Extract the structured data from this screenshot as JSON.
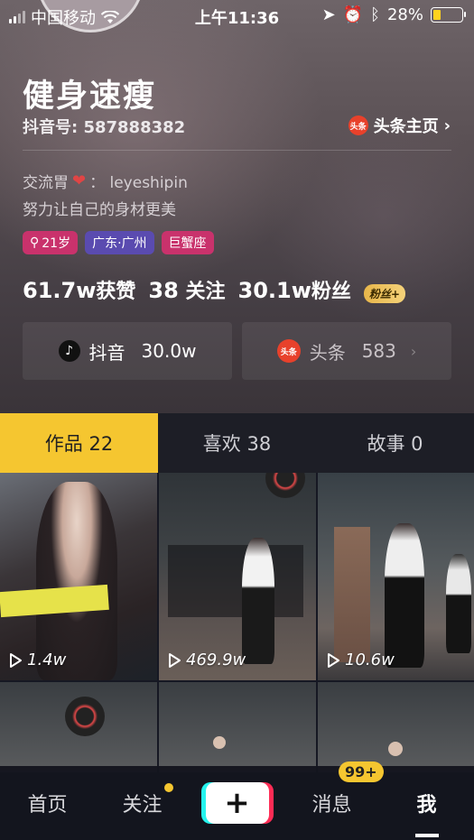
{
  "status_bar": {
    "carrier": "中国移动",
    "time": "上午11:36",
    "battery": "28%"
  },
  "profile": {
    "name": "健身速瘦",
    "douyin_id": "抖音号: 587888382",
    "toutiao_home": "头条主页",
    "toutiao_logo_text": "头条",
    "bio_prefix": "交流胃",
    "bio_suffix": "：  leyeshipin",
    "bio_line2": "努力让自己的身材更美",
    "tags": [
      "21岁",
      "广东·广州",
      "巨蟹座"
    ],
    "likes_num": "61.7w",
    "likes_label": "获赞",
    "following_num": "38",
    "following_label": "关注",
    "fans_num": "30.1w",
    "fans_label": "粉丝",
    "fans_badge": "粉丝+"
  },
  "platforms": {
    "douyin_label": "抖音",
    "douyin_count": "30.0w",
    "toutiao_label": "头条",
    "toutiao_count": "583"
  },
  "tabs": [
    {
      "label": "作品 22"
    },
    {
      "label": "喜欢 38"
    },
    {
      "label": "故事 0"
    }
  ],
  "videos": [
    {
      "plays": "1.4w"
    },
    {
      "plays": "469.9w"
    },
    {
      "plays": "10.6w"
    }
  ],
  "bottom_nav": {
    "home": "首页",
    "follow": "关注",
    "messages": "消息",
    "messages_badge": "99+",
    "me": "我"
  },
  "colors": {
    "accent": "#f5c630",
    "tag_pink": "#c9326c",
    "tag_purple": "#5a4bb0"
  }
}
